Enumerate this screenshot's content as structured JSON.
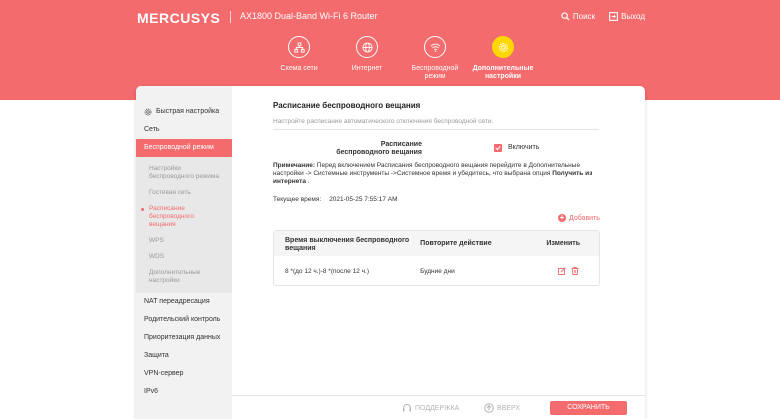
{
  "header": {
    "brand": "MERCUSYS",
    "model": "AX1800 Dual-Band Wi-Fi 6 Router",
    "search_label": "Поиск",
    "logout_label": "Выход",
    "accent_color": "#f36b6d"
  },
  "nav": {
    "items": [
      {
        "label": "Схема сети",
        "icon": "network-map-icon"
      },
      {
        "label": "Интернет",
        "icon": "globe-icon"
      },
      {
        "label": "Беспроводной режим",
        "icon": "wifi-icon"
      },
      {
        "label": "Дополнительные настройки",
        "icon": "gear-icon",
        "active": true
      }
    ]
  },
  "sidebar": {
    "quick_setup": "Быстрая настройка",
    "network": "Сеть",
    "wireless": "Беспроводной режим",
    "sub_items": [
      "Настройки беспроводного режима",
      "Гостевая сеть",
      "Расписание беспроводного вещания",
      "WPS",
      "WDS",
      "Дополнительные настройки"
    ],
    "items_after": [
      "NAT переадресация",
      "Родительский контроль",
      "Приоритезация данных",
      "Защита",
      "VPN-сервер",
      "IPv6"
    ]
  },
  "main": {
    "title": "Расписание беспроводного вещания",
    "subtitle": "Настройте расписание автоматического отключения беспроводной сети.",
    "toggle_label": "Расписание беспроводного вещания",
    "enable_label": "Включить",
    "enabled": true,
    "note_prefix": "Примечание:",
    "note_body": " Перед включением Расписания беспроводного вещания перейдите в Дополнительные настройки -> Системные инструменты ->Системное время и убедитесь, что выбрана опция ",
    "note_bold": "Получить из интернета",
    "note_end": " .",
    "time_label": "Текущее время:",
    "time_value": "2021-05-25 7:55:17 AM",
    "add_label": "Добавить"
  },
  "table": {
    "headers": [
      "Время выключения беспроводного вещания",
      "Повторите действие",
      "Изменить"
    ],
    "rows": [
      {
        "time": "8 *(до 12 ч.)-8 *(после 12 ч.)",
        "repeat": "Будние дни"
      }
    ]
  },
  "footer": {
    "support": "ПОДДЕРЖКА",
    "top": "ВВЕРХ",
    "save": "СОХРАНИТЬ"
  }
}
